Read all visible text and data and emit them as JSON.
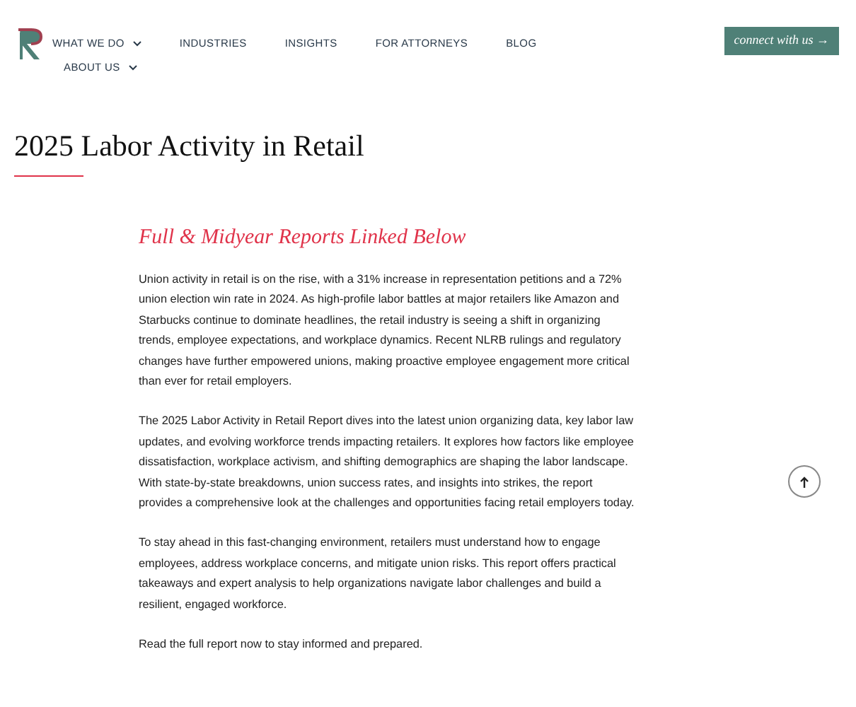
{
  "nav": {
    "items": [
      {
        "label": "WHAT WE DO",
        "kind": "dropdown"
      },
      {
        "label": "INDUSTRIES",
        "kind": "link"
      },
      {
        "label": "INSIGHTS",
        "kind": "link"
      },
      {
        "label": "FOR ATTORNEYS",
        "kind": "link"
      },
      {
        "label": "BLOG",
        "kind": "link"
      },
      {
        "label": "ABOUT US",
        "kind": "dropdown"
      }
    ],
    "cta": "connect with us →"
  },
  "page": {
    "title": "2025 Labor Activity in Retail",
    "subtitle": "Full & Midyear Reports Linked Below",
    "paragraphs": [
      "Union activity in retail is on the rise, with a 31% increase in representation petitions and a 72% union election win rate in 2024. As high-profile labor battles at major retailers like Amazon and Starbucks continue to dominate headlines, the retail industry is seeing a shift in organizing trends, employee expectations, and workplace dynamics. Recent NLRB rulings and regulatory changes have further empowered unions, making proactive employee engagement more critical than ever for retail employers.",
      "The 2025 Labor Activity in Retail Report dives into the latest union organizing data, key labor law updates, and evolving workforce trends impacting retailers. It explores how factors like employee dissatisfaction, workplace activism, and shifting demographics are shaping the labor landscape. With state-by-state breakdowns, union success rates, and insights into strikes, the report provides a comprehensive look at the challenges and opportunities facing retail employers today.",
      "To stay ahead in this fast-changing environment, retailers must understand how to engage employees, address workplace concerns, and mitigate union risks. This report offers practical takeaways and expert analysis to help organizations navigate labor challenges and build a resilient, engaged workforce.",
      "Read the full report now to stay informed and prepared."
    ]
  }
}
